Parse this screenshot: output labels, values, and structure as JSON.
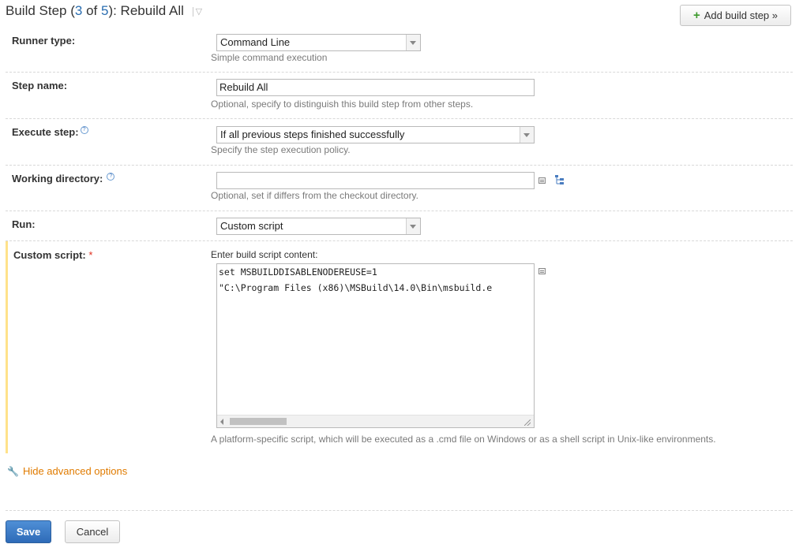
{
  "header": {
    "prefix": "Build Step (",
    "current": "3",
    "of_word": " of ",
    "total": "5",
    "suffix": "): Rebuild All"
  },
  "add_button": {
    "label": "Add build step »"
  },
  "runner_type": {
    "label": "Runner type:",
    "value": "Command Line",
    "hint": "Simple command execution"
  },
  "step_name": {
    "label": "Step name:",
    "value": "Rebuild All",
    "hint": "Optional, specify to distinguish this build step from other steps."
  },
  "execute_step": {
    "label": "Execute step:",
    "value": "If all previous steps finished successfully",
    "hint": "Specify the step execution policy."
  },
  "working_directory": {
    "label": "Working directory:",
    "value": "",
    "hint": "Optional, set if differs from the checkout directory."
  },
  "run": {
    "label": "Run:",
    "value": "Custom script"
  },
  "custom_script": {
    "label": "Custom script:",
    "required_marker": "*",
    "caption": "Enter build script content:",
    "lines": [
      "set MSBUILDDISABLENODEREUSE=1",
      "\"C:\\Program Files (x86)\\MSBuild\\14.0\\Bin\\msbuild.e"
    ],
    "hint": "A platform-specific script, which will be executed as a .cmd file on Windows or as a shell script in Unix-like environments."
  },
  "advanced_link": {
    "label": "Hide advanced options"
  },
  "buttons": {
    "save": "Save",
    "cancel": "Cancel"
  },
  "colors": {
    "accent_orange": "#e07b00",
    "primary_blue": "#2e6bb8",
    "highlight_bar": "#ffe28a"
  },
  "icons": [
    "help-icon",
    "chevron-down-icon",
    "plus-icon",
    "edit-icon",
    "tree-icon",
    "wrench-icon"
  ]
}
